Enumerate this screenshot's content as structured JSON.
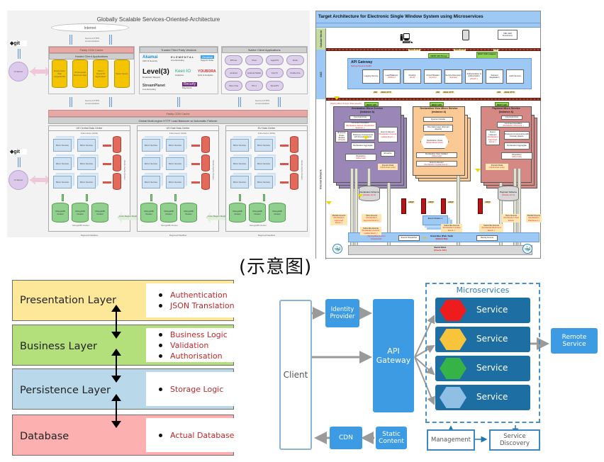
{
  "soa": {
    "title": "Globally Scalable Services-Oriented-Architecture",
    "internet": "Internet",
    "secure_note": "Secure HTTPS communication",
    "git_label": "git",
    "ci_server": "CI Server",
    "deploy_note": "Automated Deploys",
    "fastly_cdn": "Fastly CDN Cache",
    "hosted_apps": {
      "title": "Hosted Client Applications",
      "items": [
        "Responsive Web (AngularJS)",
        "Chromecast Receiver App",
        "Tizen / OperaTV Application",
        "Static Assets"
      ]
    },
    "vendors": {
      "title": "Trusted Third Party Vendors",
      "items": [
        {
          "name": "Akamai",
          "caption": "CDN & Security"
        },
        {
          "name": "ELEMENTAL",
          "caption": "Live Encoding"
        },
        {
          "name": "Zendesk",
          "caption": "Support Suite"
        },
        {
          "name": "Level(3)",
          "caption": "Broadcast Teleport"
        },
        {
          "name": "Keen IO",
          "caption": "Analytics"
        },
        {
          "name": "YOUBORA",
          "caption": "QoS & Analytics"
        },
        {
          "name": "StreamPlanet",
          "caption": "Live Encoding"
        },
        {
          "name": "Recurly",
          "caption": "Payments"
        }
      ]
    },
    "native_apps": {
      "title": "Native Client Applications",
      "items": [
        "iPhone",
        "iPad",
        "AppleTV",
        "Roku",
        "Android",
        "Android Tablet",
        "FireTV",
        "Kindle Fire",
        "Xbox One",
        "PS 4",
        "SmartTV"
      ]
    },
    "load_balancer": "Global Multi-region HTTP Load Balancer w/ Automatic Failover",
    "data_centers": [
      {
        "name": "US Central Data Center"
      },
      {
        "name": "US East Data Center"
      },
      {
        "name": "EU Data Center"
      }
    ],
    "kubernetes": "Kubernetes (GKE)",
    "micro_service": "Micro Service",
    "redis": "Redis Cache Cluster",
    "mongo": "MongoDB Cluster",
    "cross_region": "Cross Region Replication",
    "regional_dataflow": "Regional Dataflow"
  },
  "esw": {
    "title": "Target Architecture for Electronic Single Window System using Microservices",
    "zones": [
      "Outside World",
      "DMZ",
      "Internal Network"
    ],
    "outside": {
      "document": "XML (EDI Document)"
    },
    "json_http": "JSON HTTP",
    "ftp": "FTP",
    "jwt": "JWT",
    "rest_api_proxy": "REST API Proxy",
    "rest_edi_adapter": "REST EDI Adapter",
    "rest_api": "REST API",
    "api_gateway": {
      "title": "API Gateway",
      "subtitle": "Spring Cloud & Netflix",
      "modules": [
        {
          "name": "Logging Service",
          "tech": ""
        },
        {
          "name": "Load Balancer",
          "tech": "(Ribbon)"
        },
        {
          "name": "Routing",
          "tech": "(Zuul)"
        },
        {
          "name": "Circuit Breaker",
          "tech": "(Hystrix)"
        },
        {
          "name": "Service Discovery",
          "tech": "(Eureka)"
        },
        {
          "name": "Authentication & Authorization",
          "tech": "(OAuth..)"
        },
        {
          "name": "Session Replication",
          "tech": ""
        },
        {
          "name": "Audit Service",
          "tech": ""
        }
      ]
    },
    "framework_note": "(Spring Boot & Axon Framework)",
    "services": [
      {
        "title": "Declaration Micro Service",
        "instance": "(instance A)",
        "boxes": [
          {
            "name": "Command bus",
            "tech": ""
          },
          {
            "name": "Command Handlers",
            "tech": "(Declaration Submit, Declaration Approve..)"
          },
          {
            "name": "Business Rules Engine",
            "tech": "(Drools)"
          },
          {
            "name": "Business Components with Domain objects",
            "tech": ""
          },
          {
            "name": "Event Listeners",
            "tech": "(Declaration Cancel, update Event..)"
          },
          {
            "name": "Declaration Aggregate",
            "tech": ""
          },
          {
            "name": "Repository",
            "tech": "(Hibernate)"
          },
          {
            "name": "Ehcache",
            "tech": ""
          }
        ],
        "domain_data": {
          "name": "Domain Data",
          "tech": "(Optimized Lock)"
        },
        "schema": {
          "name": "Declaration Schema",
          "tech": "(Oracle 12 C)"
        }
      },
      {
        "title": "Declaration View Micro Service",
        "instance": "(instance A)",
        "boxes": [
          {
            "name": "Queries Facade",
            "tech": ""
          },
          {
            "name": "Thin Data Layer (Domain objects)",
            "tech": ""
          },
          {
            "name": "Declaration Views",
            "tech": "(Materialized View)"
          },
          {
            "name": "Declaration View Updater",
            "tech": "(Hibernate)"
          },
          {
            "name": "Event Listeners",
            "tech": "(Declaration Update Event..)"
          }
        ]
      },
      {
        "title": "Payment Micro Service",
        "instance": "(instance A)",
        "boxes": [
          {
            "name": "Command bus",
            "tech": ""
          },
          {
            "name": "Command Handlers",
            "tech": "(Declaration Payment..)"
          },
          {
            "name": "Event Listeners",
            "tech": "(Declaration Approved Event..)"
          },
          {
            "name": "Business Components with Domain objects",
            "tech": ""
          },
          {
            "name": "Declaration Aggregate",
            "tech": ""
          },
          {
            "name": "Repository",
            "tech": "(Hibernate)"
          }
        ],
        "domain_data": {
          "name": "Domain Data",
          "tech": "(Optimized Lock)"
        },
        "schema": {
          "name": "Payment Schema",
          "tech": "(Oracle 12 C)"
        }
      }
    ],
    "amqp": "AMQP",
    "event_cluster": "Event Cluster 1",
    "notes": [
      {
        "name": "Publish Events",
        "tech": "(Declaration Approved Event..)"
      },
      {
        "name": "Store Events",
        "tech": "(Declaration Approved Event..)"
      },
      {
        "name": "Subscribe Events",
        "tech": "(Declaration Cancel, update Event..)"
      },
      {
        "name": "Subscribe Events",
        "tech": "(Declaration Update Event..)"
      },
      {
        "name": "Subscribe Events",
        "tech": "(DeclarationApproved Event..)"
      },
      {
        "name": "Store Events",
        "tech": "(Declaration Paid Event)"
      },
      {
        "name": "Publish Events",
        "tech": "(Declaration Paid Event..)"
      }
    ],
    "event_bus": {
      "events_dispatcher": "Events Dispatcher",
      "name": "Event Bus (Pub / Sub)",
      "tech": "(Rabbit MQ)",
      "replay": "Replay Events"
    },
    "event_store": {
      "name": "Event Store",
      "tech": "(Oracle 12C)"
    }
  },
  "caption": "(示意图)",
  "layers": [
    {
      "name": "Presentation Layer",
      "color": "#fde89a",
      "items": [
        "Authentication",
        "JSON Translation"
      ]
    },
    {
      "name": "Business Layer",
      "color": "#b3e07a",
      "items": [
        "Business Logic",
        "Validation",
        "Authorisation"
      ]
    },
    {
      "name": "Persistence Layer",
      "color": "#b9d9ea",
      "items": [
        "Storage Logic"
      ]
    },
    {
      "name": "Database",
      "color": "#fdb0b0",
      "items": [
        "Actual Database"
      ]
    }
  ],
  "msa": {
    "client": "Client",
    "identity_provider": "Identity Provider",
    "api_gateway": "API Gateway",
    "cdn": "CDN",
    "static_content": "Static Content",
    "microservices_title": "Microservices",
    "services": [
      {
        "label": "Service",
        "hex_color": "#ee1c1c"
      },
      {
        "label": "Service",
        "hex_color": "#f8c43c"
      },
      {
        "label": "Service",
        "hex_color": "#36b346"
      },
      {
        "label": "Service",
        "hex_color": "#8fbfe4"
      }
    ],
    "remote_service": "Remote Service",
    "management": "Management",
    "service_discovery": "Service Discovery"
  }
}
